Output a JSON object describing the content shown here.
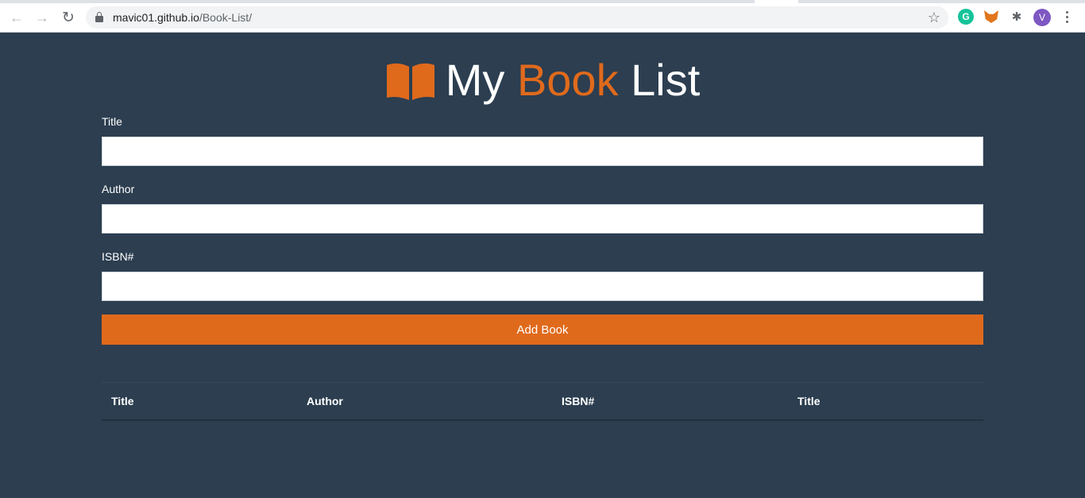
{
  "browser": {
    "back_icon": "←",
    "forward_icon": "→",
    "reload_icon": "↻",
    "url_host": "mavic01.github.io",
    "url_path": "/Book-List/",
    "star_icon": "☆",
    "grammarly_letter": "G",
    "puzzle_icon": "✱",
    "avatar_letter": "V"
  },
  "header": {
    "title_part1": "My ",
    "title_part2": "Book",
    "title_part3": " List",
    "accent_color": "#e06a1c"
  },
  "form": {
    "title_label": "Title",
    "title_value": "",
    "author_label": "Author",
    "author_value": "",
    "isbn_label": "ISBN#",
    "isbn_value": "",
    "submit_label": "Add Book"
  },
  "table": {
    "columns": [
      "Title",
      "Author",
      "ISBN#",
      "Title"
    ]
  }
}
